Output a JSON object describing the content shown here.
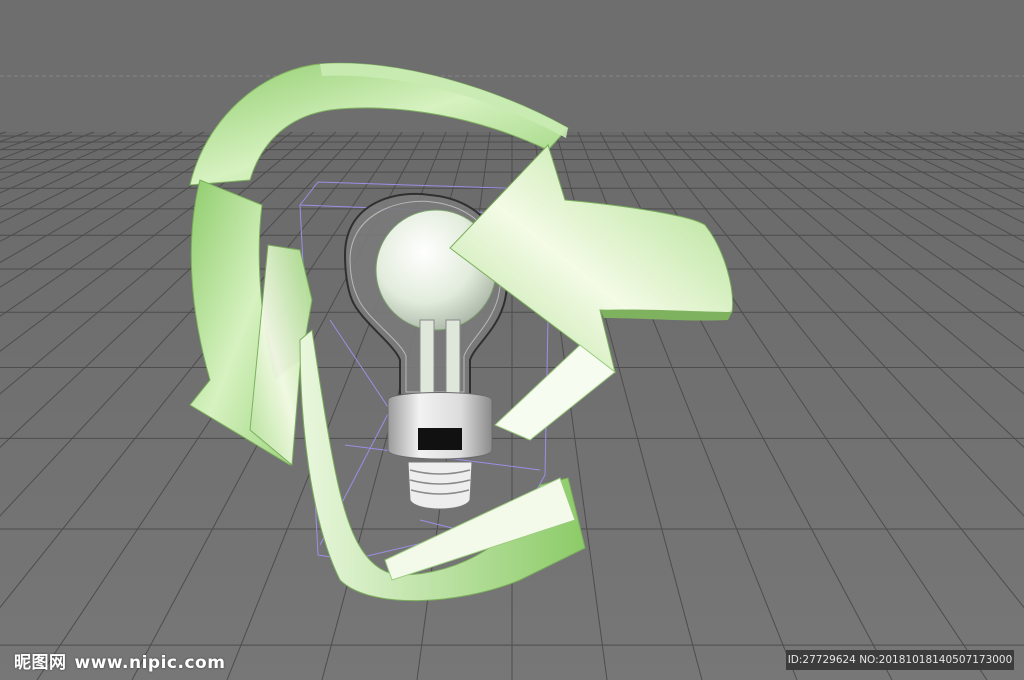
{
  "viewport": {
    "background_top": "#6e6e6e",
    "floor_color": "#6a6a6a",
    "grid_color": "#4a4a4a",
    "horizon_line_color": "#7a7a7a"
  },
  "model": {
    "object": "lightbulb-with-recycle-arrows",
    "arrow_color": "#a8dc8c",
    "bounding_box_color": "#9b8fe6"
  },
  "watermark": {
    "site": "昵图网",
    "url": "www.nipic.com",
    "id_text": "ID:27729624 NO:20181018140507173000"
  }
}
